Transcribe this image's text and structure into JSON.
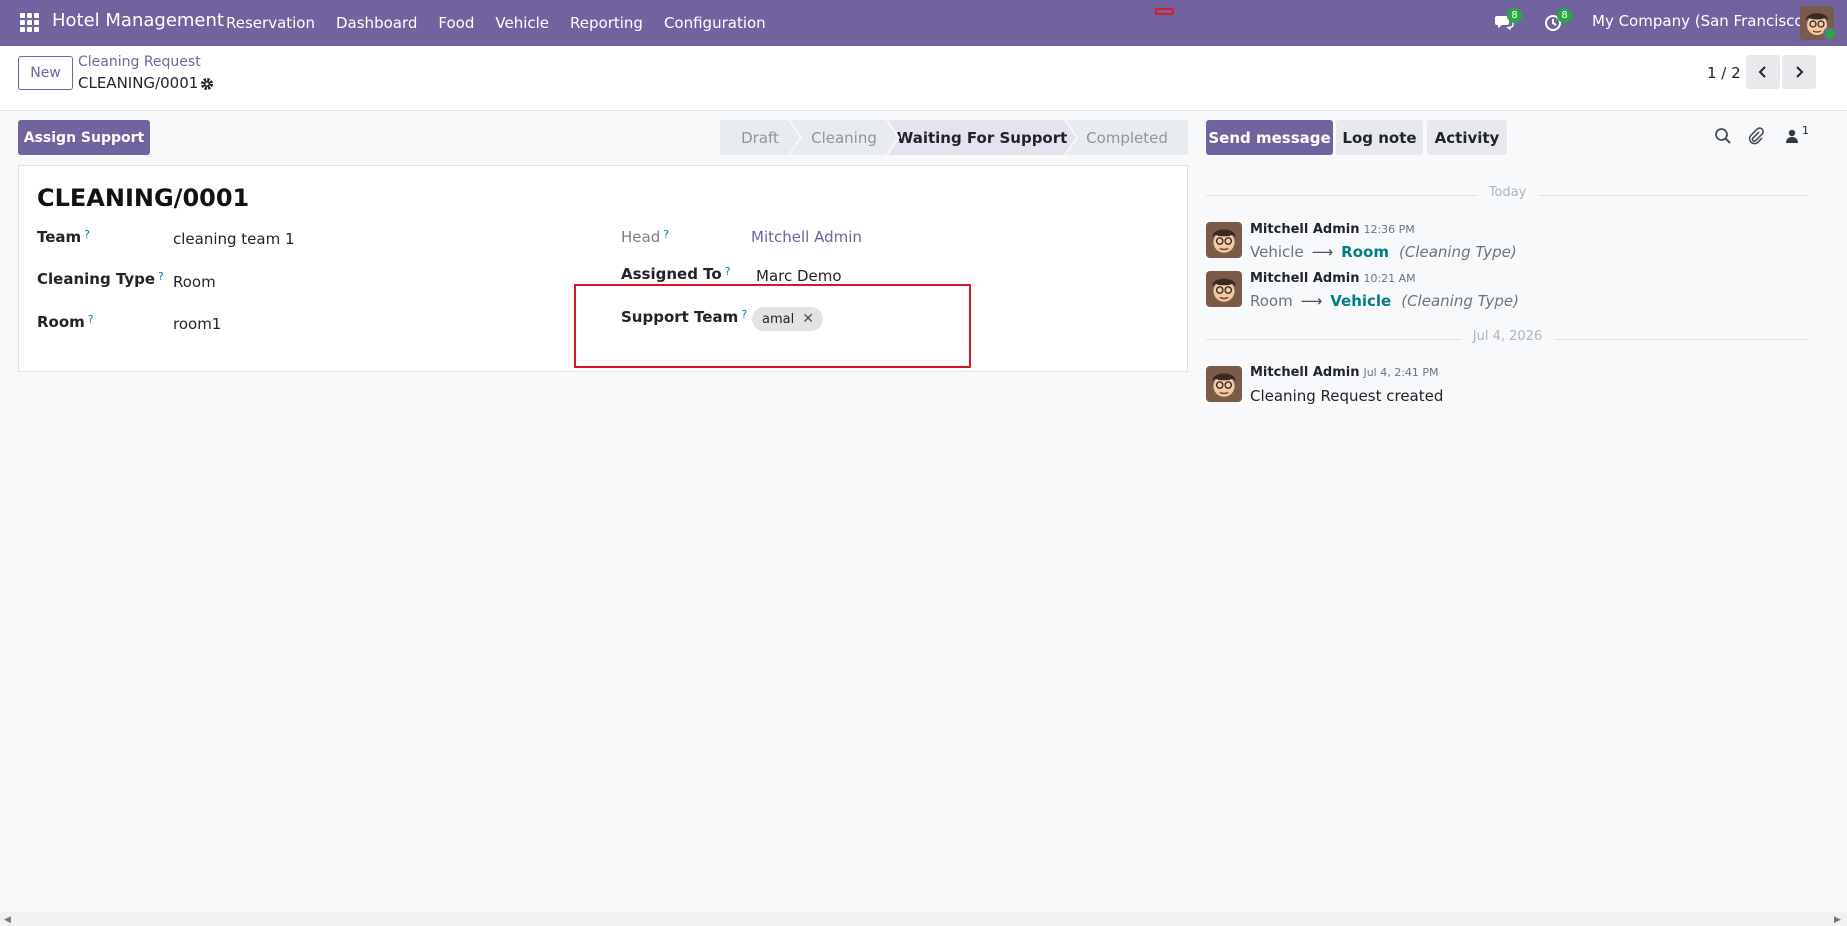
{
  "navbar": {
    "brand": "Hotel Management",
    "menu": [
      "Reservation",
      "Dashboard",
      "Food",
      "Vehicle",
      "Reporting",
      "Configuration"
    ],
    "messages_badge": "8",
    "activities_badge": "8",
    "company": "My Company (San Francisco)",
    "bg_color": "#71639e"
  },
  "control": {
    "new_label": "New",
    "breadcrumb_parent": "Cleaning Request",
    "breadcrumb_current": "CLEANING/0001",
    "pager": "1 / 2"
  },
  "statusbar": {
    "action_button": "Assign Support",
    "stages": [
      "Draft",
      "Cleaning",
      "Waiting For Support",
      "Completed"
    ],
    "active_stage": "Waiting For Support"
  },
  "form": {
    "title": "CLEANING/0001",
    "left": [
      {
        "label": "Team",
        "value": "cleaning team 1"
      },
      {
        "label": "Cleaning Type",
        "value": "Room"
      },
      {
        "label": "Room",
        "value": "room1"
      }
    ],
    "right": {
      "head_label": "Head",
      "head_value": "Mitchell Admin",
      "assigned_label": "Assigned To",
      "assigned_value": "Marc Demo",
      "support_label": "Support Team",
      "support_tags": [
        "amal"
      ]
    },
    "help_marker": "?"
  },
  "chatter": {
    "send_message": "Send message",
    "log_note": "Log note",
    "activity": "Activity",
    "followers_count": "1",
    "groups": [
      {
        "date": "Today",
        "messages": [
          {
            "author": "Mitchell Admin",
            "time": "12:36 PM",
            "old": "Vehicle",
            "new": "Room",
            "field": "(Cleaning Type)"
          },
          {
            "author": "Mitchell Admin",
            "time": "10:21 AM",
            "old": "Room",
            "new": "Vehicle",
            "field": "(Cleaning Type)"
          }
        ]
      },
      {
        "date": "Jul 4, 2026",
        "messages": [
          {
            "author": "Mitchell Admin",
            "time": "Jul 4, 2:41 PM",
            "text": "Cleaning Request created"
          }
        ]
      }
    ],
    "arrow_glyph": "⟶"
  }
}
